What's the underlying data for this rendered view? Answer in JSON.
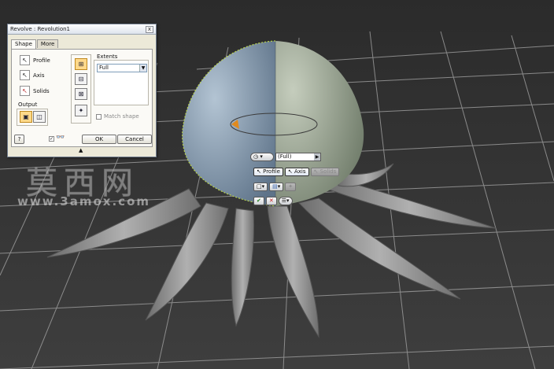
{
  "dialog": {
    "title": "Revolve : Revolution1",
    "close_glyph": "x",
    "tabs": [
      {
        "label": "Shape"
      },
      {
        "label": "More"
      }
    ],
    "selectors": {
      "profile": "Profile",
      "axis": "Axis",
      "solids": "Solids"
    },
    "output_label": "Output",
    "extents_label": "Extents",
    "extents_value": "Full",
    "match_shape_label": "Match shape",
    "ok_label": "OK",
    "cancel_label": "Cancel",
    "help_glyph": "?"
  },
  "minitoolbar": {
    "extent_value": "(Full)",
    "profile_label": "Profile",
    "axis_label": "Axis",
    "solids_label": "Solids"
  },
  "watermark": {
    "chinese": "莫西网",
    "url": "www.3amox.com"
  },
  "colors": {
    "viewport_background": "#2f2f2f",
    "grid_line": "#9a9a9a",
    "head_left": "#8fa6bb",
    "head_right": "#a9b5a2",
    "tentacle": "#8c8c8c",
    "dialog_background": "#ece9d8"
  }
}
